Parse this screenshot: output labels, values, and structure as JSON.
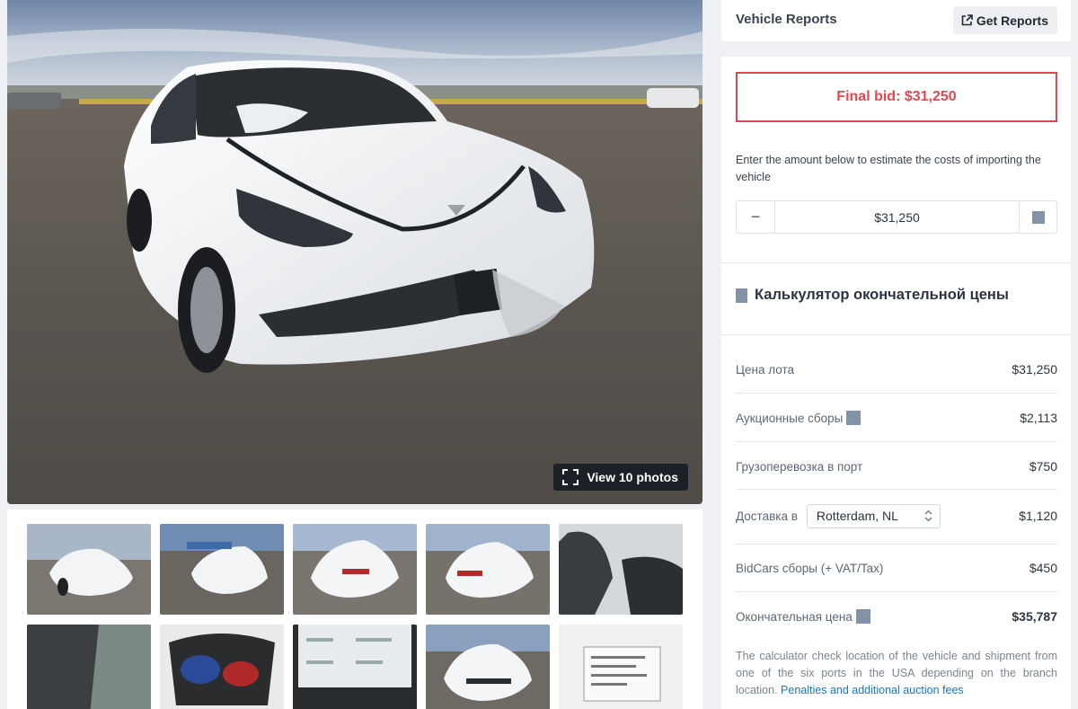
{
  "gallery": {
    "view_photos_label": "View 10 photos",
    "thumbnails": [
      {
        "name": "front-left damaged exterior"
      },
      {
        "name": "front damage closeup"
      },
      {
        "name": "rear three-quarter"
      },
      {
        "name": "rear left three-quarter"
      },
      {
        "name": "front seats interior"
      },
      {
        "name": "rear seats interior"
      },
      {
        "name": "trunk cargo"
      },
      {
        "name": "dashboard screen"
      },
      {
        "name": "front damage"
      },
      {
        "name": "vehicle label sticker"
      }
    ]
  },
  "reports": {
    "title": "Vehicle Reports",
    "button_label": "Get Reports",
    "button_icon": "external-link-icon"
  },
  "bid": {
    "final_bid": "Final bid: $31,250",
    "accent_color": "#e2474f",
    "estimate_text": "Enter the amount below to estimate the costs of importing the vehicle",
    "amount_value": "$31,250",
    "minus_label": "−"
  },
  "calculator": {
    "title": "Калькулятор окончательной цены",
    "rows": [
      {
        "label": "Цена лота",
        "value": "$31,250"
      },
      {
        "label": "Аукционные сборы",
        "value": "$2,113"
      },
      {
        "label": "Грузоперевозка в порт",
        "value": "$750"
      },
      {
        "label": "Доставка в",
        "value": "$1,120",
        "select_value": "Rotterdam, NL"
      },
      {
        "label": "BidCars сборы (+ VAT/Tax)",
        "value": "$450"
      },
      {
        "label": "Окончательная цена",
        "value": "$35,787"
      }
    ],
    "footnote": "The calculator check location of the vehicle and shipment from one of the six ports in the USA depending on the branch location.",
    "footnote_link": "Penalties and additional auction fees",
    "link_color": "#1479c9"
  }
}
